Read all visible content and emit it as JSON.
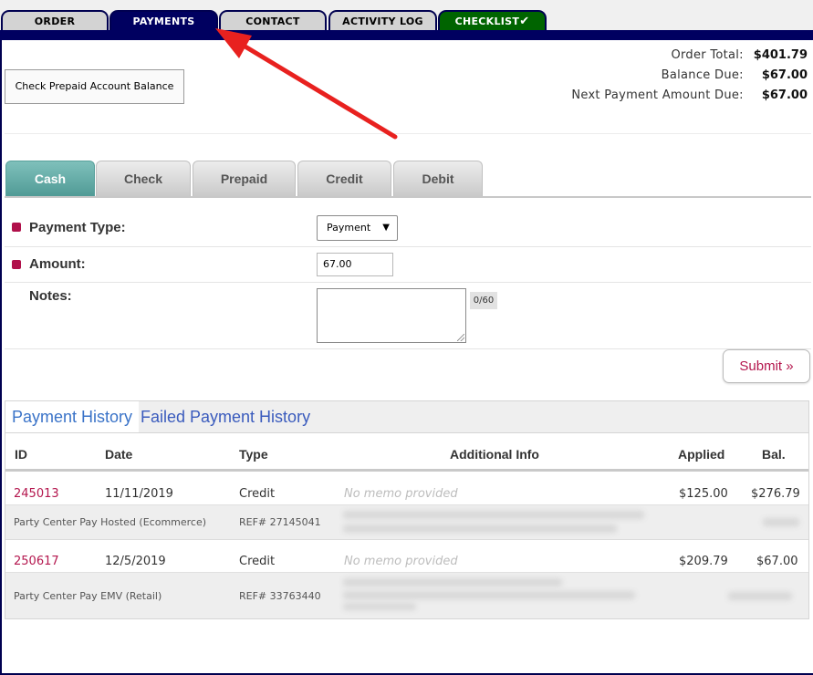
{
  "top_tabs": [
    {
      "label": "ORDER",
      "active": false
    },
    {
      "label": "PAYMENTS",
      "active": true
    },
    {
      "label": "CONTACT",
      "active": false
    },
    {
      "label": "ACTIVITY LOG",
      "active": false
    },
    {
      "label": "CHECKLIST",
      "active": false,
      "icon": "check-icon"
    }
  ],
  "prepaid_button": "Check Prepaid Account Balance",
  "totals": {
    "order_total_label": "Order Total:",
    "order_total": "$401.79",
    "balance_due_label": "Balance Due:",
    "balance_due": "$67.00",
    "next_payment_label": "Next Payment Amount Due:",
    "next_payment": "$67.00"
  },
  "method_tabs": [
    "Cash",
    "Check",
    "Prepaid",
    "Credit",
    "Debit"
  ],
  "form": {
    "payment_type_label": "Payment Type:",
    "payment_type_value": "Payment",
    "amount_label": "Amount:",
    "amount_value": "67.00",
    "notes_label": "Notes:",
    "notes_counter": "0/60",
    "submit_label": "Submit »"
  },
  "history": {
    "tabs": [
      "Payment History",
      "Failed Payment History"
    ],
    "headers": [
      "ID",
      "Date",
      "Type",
      "Additional Info",
      "Applied",
      "Bal."
    ],
    "rows": [
      {
        "id": "245013",
        "date": "11/11/2019",
        "type": "Credit",
        "memo": "No memo provided",
        "applied": "$125.00",
        "bal": "$276.79",
        "processor": "Party Center Pay Hosted (Ecommerce)",
        "ref": "REF# 27145041"
      },
      {
        "id": "250617",
        "date": "12/5/2019",
        "type": "Credit",
        "memo": "No memo provided",
        "applied": "$209.79",
        "bal": "$67.00",
        "processor": "Party Center Pay EMV (Retail)",
        "ref": "REF# 33763440"
      }
    ]
  },
  "colors": {
    "nav_dark": "#000060",
    "checklist_green": "#006400",
    "accent_red": "#b4174e",
    "arrow_red": "#e8211f",
    "tab_teal": "#5fa8a2"
  }
}
